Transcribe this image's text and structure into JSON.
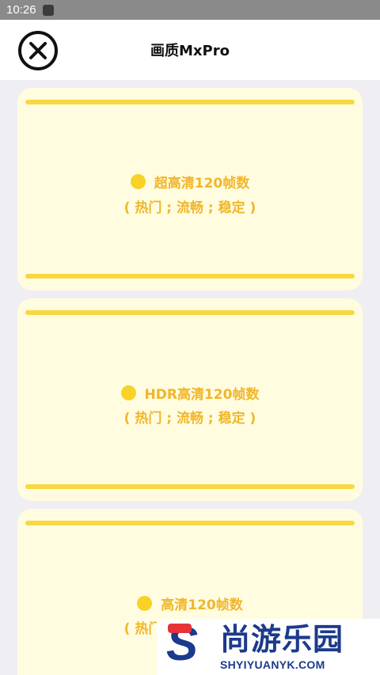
{
  "status_bar": {
    "time": "10:26"
  },
  "header": {
    "title": "画质MxPro"
  },
  "cards": [
    {
      "title": "超高清120帧数",
      "subtitle": "( 热门 ; 流畅 ; 稳定 )"
    },
    {
      "title": "HDR高清120帧数",
      "subtitle": "( 热门 ; 流畅 ; 稳定 )"
    },
    {
      "title": "高清120帧数",
      "subtitle": "( 热门 ; 流畅 ; 稳定 )"
    }
  ],
  "watermark": {
    "letter": "S",
    "name": "尚游乐园",
    "domain": "SHYIYUANYK.COM"
  },
  "colors": {
    "accent": "#f8d842",
    "text": "#f1b62a",
    "card_bg": "#fffce0",
    "watermark": "#1c3a8c"
  }
}
